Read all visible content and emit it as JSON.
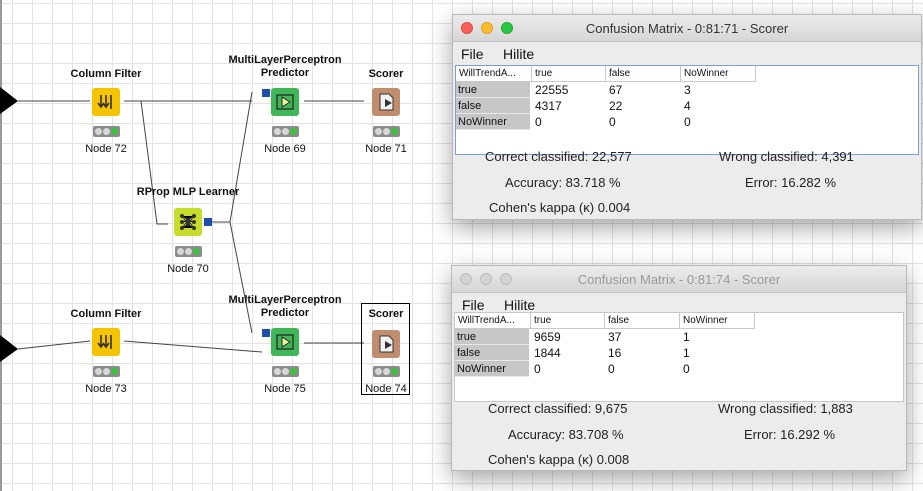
{
  "workflow": {
    "nodes": [
      {
        "id": "cf72",
        "title": "Column Filter",
        "label": "Node 72",
        "kind": "column-filter"
      },
      {
        "id": "mlp69",
        "title": "MultiLayerPerceptron Predictor",
        "label": "Node 69",
        "kind": "predictor"
      },
      {
        "id": "sc71",
        "title": "Scorer",
        "label": "Node 71",
        "kind": "scorer"
      },
      {
        "id": "rp70",
        "title": "RProp MLP Learner",
        "label": "Node 70",
        "kind": "learner"
      },
      {
        "id": "cf73",
        "title": "Column Filter",
        "label": "Node 73",
        "kind": "column-filter"
      },
      {
        "id": "mlp75",
        "title": "MultiLayerPerceptron Predictor",
        "label": "Node 75",
        "kind": "predictor"
      },
      {
        "id": "sc74",
        "title": "Scorer",
        "label": "Node 74",
        "kind": "scorer"
      }
    ],
    "colors": {
      "column_filter": "#f4c400",
      "predictor": "#3fb657",
      "scorer": "#c08e6e",
      "learner": "#c6dc2a",
      "port_blue": "#1f4ea8",
      "status_green": "#3cc33c"
    }
  },
  "windows": [
    {
      "title": "Confusion Matrix - 0:81:71 - Scorer",
      "active": true,
      "menu": [
        "File",
        "Hilite"
      ],
      "columns": [
        "WillTrendA...",
        "true",
        "false",
        "NoWinner"
      ],
      "rows": [
        {
          "label": "true",
          "cells": [
            "22555",
            "67",
            "3"
          ]
        },
        {
          "label": "false",
          "cells": [
            "4317",
            "22",
            "4"
          ]
        },
        {
          "label": "NoWinner",
          "cells": [
            "0",
            "0",
            "0"
          ]
        }
      ],
      "stats": {
        "correct": "Correct classified: 22,577",
        "wrong": "Wrong classified: 4,391",
        "accuracy": "Accuracy: 83.718 %",
        "error": "Error: 16.282 %",
        "kappa": "Cohen's kappa (κ) 0.004"
      }
    },
    {
      "title": "Confusion Matrix - 0:81:74 - Scorer",
      "active": false,
      "menu": [
        "File",
        "Hilite"
      ],
      "columns": [
        "WillTrendA...",
        "true",
        "false",
        "NoWinner"
      ],
      "rows": [
        {
          "label": "true",
          "cells": [
            "9659",
            "37",
            "1"
          ]
        },
        {
          "label": "false",
          "cells": [
            "1844",
            "16",
            "1"
          ]
        },
        {
          "label": "NoWinner",
          "cells": [
            "0",
            "0",
            "0"
          ]
        }
      ],
      "stats": {
        "correct": "Correct classified: 9,675",
        "wrong": "Wrong classified: 1,883",
        "accuracy": "Accuracy: 83.708 %",
        "error": "Error: 16.292 %",
        "kappa": "Cohen's kappa (κ) 0.008"
      }
    }
  ]
}
